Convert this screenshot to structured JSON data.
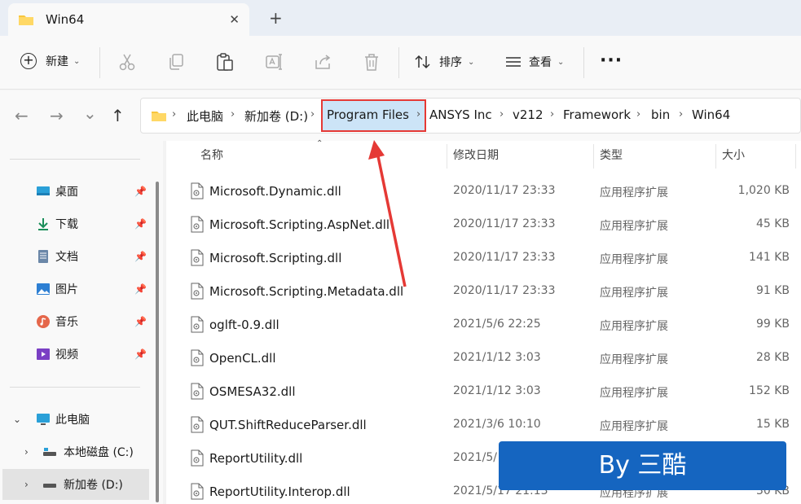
{
  "window": {
    "tab_title": "Win64",
    "close_glyph": "✕",
    "new_tab_glyph": "+"
  },
  "toolbar": {
    "new_label": "新建",
    "sort_label": "排序",
    "view_label": "查看",
    "more_glyph": "···",
    "icons": [
      "cut-icon",
      "copy-icon",
      "paste-icon",
      "rename-icon",
      "share-icon",
      "delete-icon"
    ]
  },
  "nav": {
    "back_glyph": "←",
    "forward_glyph": "→",
    "recent_glyph": "⌄",
    "up_glyph": "↑"
  },
  "breadcrumb": [
    "此电脑",
    "新加卷 (D:)",
    "Program Files",
    "ANSYS Inc",
    "v212",
    "Framework",
    "bin",
    "Win64"
  ],
  "sidebar": {
    "quick_access": [
      {
        "label": "桌面",
        "icon": "desktop-icon"
      },
      {
        "label": "下载",
        "icon": "download-icon"
      },
      {
        "label": "文档",
        "icon": "document-icon"
      },
      {
        "label": "图片",
        "icon": "pictures-icon"
      },
      {
        "label": "音乐",
        "icon": "music-icon"
      },
      {
        "label": "视频",
        "icon": "videos-icon"
      }
    ],
    "this_pc": "此电脑",
    "drives": [
      "本地磁盘 (C:)",
      "新加卷 (D:)"
    ]
  },
  "columns": {
    "name": "名称",
    "date": "修改日期",
    "type": "类型",
    "size": "大小"
  },
  "files": [
    {
      "name": "Microsoft.Dynamic.dll",
      "date": "2020/11/17 23:33",
      "type": "应用程序扩展",
      "size": "1,020 KB"
    },
    {
      "name": "Microsoft.Scripting.AspNet.dll",
      "date": "2020/11/17 23:33",
      "type": "应用程序扩展",
      "size": "45 KB"
    },
    {
      "name": "Microsoft.Scripting.dll",
      "date": "2020/11/17 23:33",
      "type": "应用程序扩展",
      "size": "141 KB"
    },
    {
      "name": "Microsoft.Scripting.Metadata.dll",
      "date": "2020/11/17 23:33",
      "type": "应用程序扩展",
      "size": "91 KB"
    },
    {
      "name": "oglft-0.9.dll",
      "date": "2021/5/6 22:25",
      "type": "应用程序扩展",
      "size": "99 KB"
    },
    {
      "name": "OpenCL.dll",
      "date": "2021/1/12 3:03",
      "type": "应用程序扩展",
      "size": "28 KB"
    },
    {
      "name": "OSMESA32.dll",
      "date": "2021/1/12 3:03",
      "type": "应用程序扩展",
      "size": "152 KB"
    },
    {
      "name": "QUT.ShiftReduceParser.dll",
      "date": "2021/3/6 10:10",
      "type": "应用程序扩展",
      "size": "15 KB"
    },
    {
      "name": "ReportUtility.dll",
      "date": "2021/5/",
      "type": "",
      "size": ""
    },
    {
      "name": "ReportUtility.Interop.dll",
      "date": "2021/5/17 21:13",
      "type": "应用程序扩展",
      "size": "30 KB"
    }
  ],
  "watermark": "By 三酷",
  "colors": {
    "highlight_border": "#e53935",
    "arrow": "#e53935",
    "watermark_bg": "#1565c0",
    "selected_crumb_bg": "#cce4f7"
  }
}
